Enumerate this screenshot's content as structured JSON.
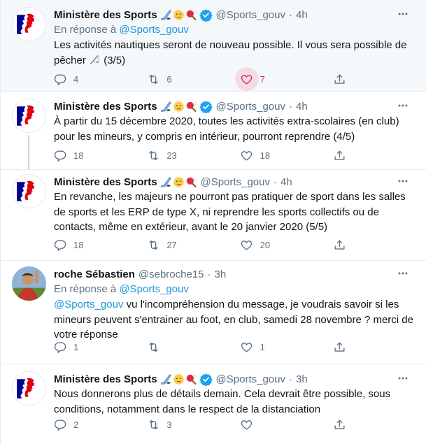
{
  "tweets": [
    {
      "name": "Ministère des Sports",
      "handle": "@Sports_gouv",
      "time": "4h",
      "reply_prefix": "En réponse à",
      "reply_to": "@Sports_gouv",
      "text": "Les activités nautiques seront de nouveau possible. Il vous sera possible de pêcher",
      "text_suffix": "(3/5)",
      "replies": "4",
      "retweets": "6",
      "likes": "7"
    },
    {
      "name": "Ministère des Sports",
      "handle": "@Sports_gouv",
      "time": "4h",
      "text": "À partir du 15 décembre 2020, toutes les activités extra-scolaires (en club) pour les mineurs, y compris en intérieur, pourront reprendre (4/5)",
      "replies": "18",
      "retweets": "23",
      "likes": "18"
    },
    {
      "name": "Ministère des Sports",
      "handle": "@Sports_gouv",
      "time": "4h",
      "text": "En revanche, les majeurs ne pourront pas pratiquer de sport dans les salles de sports et les ERP de type X, ni reprendre les sports collectifs ou de contacts, même en extérieur, avant le 20 janvier 2020 (5/5)",
      "replies": "18",
      "retweets": "27",
      "likes": "20"
    },
    {
      "name": "roche Sébastien",
      "handle": "@sebroche15",
      "time": "3h",
      "reply_prefix": "En réponse à",
      "reply_to": "@Sports_gouv",
      "mention": "@Sports_gouv",
      "text": " vu l'incompréhension du message, je voudrais savoir si les mineurs peuvent s'entrainer au foot, en club, samedi 28 novembre ? merci de votre réponse",
      "replies": "1",
      "retweets": "",
      "likes": "1"
    },
    {
      "name": "Ministère des Sports",
      "handle": "@Sports_gouv",
      "time": "3h",
      "text": "Nous donnerons plus de détails demain. Cela devrait être possible, sous conditions, notamment dans le respect de la distanciation",
      "replies": "2",
      "retweets": "3",
      "likes": ""
    }
  ],
  "dot": "·",
  "colors": {
    "accent": "#1b95e0",
    "like": "#e0245e",
    "muted": "#5b7083",
    "verified": "#1da1f2"
  },
  "icons": [
    "reply-icon",
    "retweet-icon",
    "like-icon",
    "share-icon",
    "more-icon",
    "verified-icon",
    "fishing-emoji",
    "hockey-emoji",
    "crying-emoji",
    "pingpong-emoji"
  ]
}
